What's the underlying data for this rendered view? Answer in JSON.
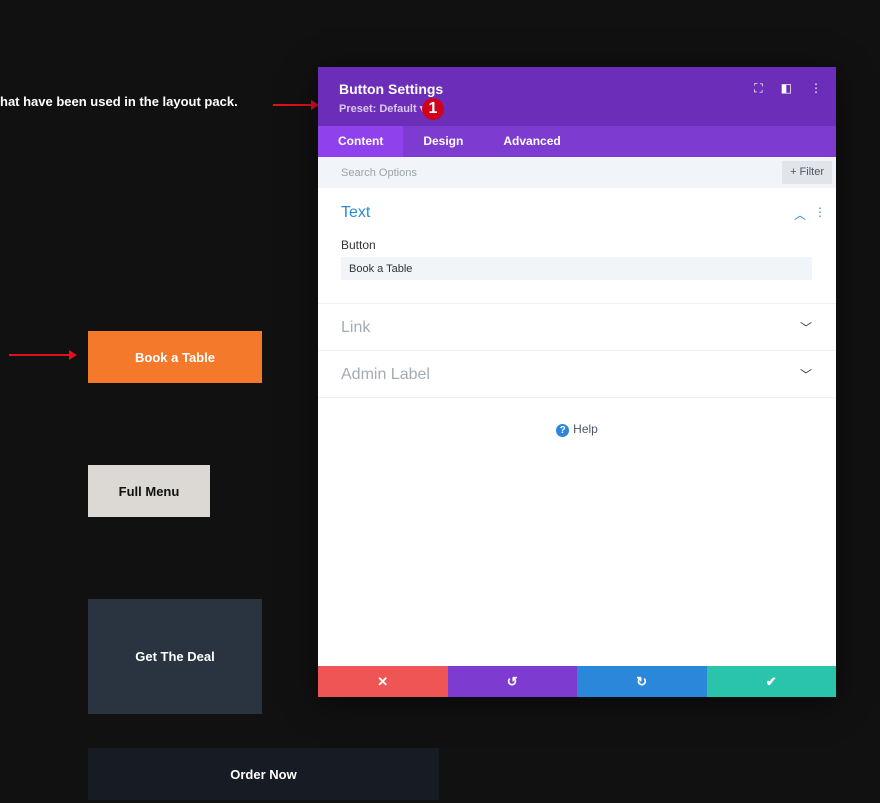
{
  "intro_text": "hat have been used in the layout pack.",
  "buttons": {
    "book": "Book a Table",
    "menu": "Full Menu",
    "deal": "Get The Deal",
    "order": "Order Now"
  },
  "modal": {
    "title": "Button Settings",
    "preset": "Preset: Default ▾",
    "badge": "1",
    "tabs": [
      "Content",
      "Design",
      "Advanced"
    ],
    "search_placeholder": "Search Options",
    "filter": "+ Filter",
    "text_section": {
      "title": "Text",
      "field_label": "Button",
      "field_value": "Book a Table"
    },
    "link_section": "Link",
    "admin_section": "Admin Label",
    "help": "Help"
  },
  "colors": {
    "purple": "#6c2eb9",
    "orange": "#f5792a",
    "cancel": "#ef5555",
    "undo": "#7e3bd0",
    "redo": "#2b87da",
    "save": "#29c4a9"
  }
}
